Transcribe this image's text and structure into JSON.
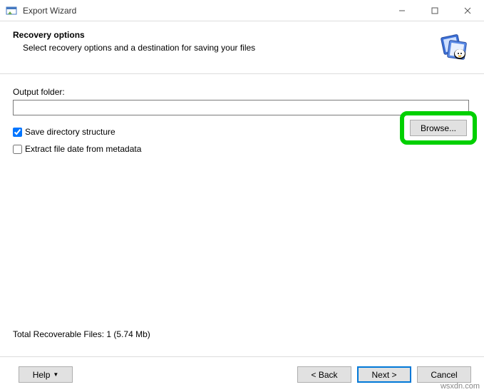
{
  "window": {
    "title": "Export Wizard"
  },
  "header": {
    "title": "Recovery options",
    "subtitle": "Select recovery options and a destination for saving your files"
  },
  "content": {
    "output_folder_label": "Output folder:",
    "output_folder_value": "",
    "save_directory_label": "Save directory structure",
    "save_directory_checked": true,
    "extract_date_label": "Extract file date from metadata",
    "extract_date_checked": false,
    "browse_label": "Browse...",
    "status_text": "Total Recoverable Files: 1 (5.74 Mb)"
  },
  "footer": {
    "help": "Help",
    "back": "< Back",
    "next": "Next >",
    "cancel": "Cancel"
  },
  "watermark": "wsxdn.com",
  "highlight": {
    "color": "#00d000"
  }
}
